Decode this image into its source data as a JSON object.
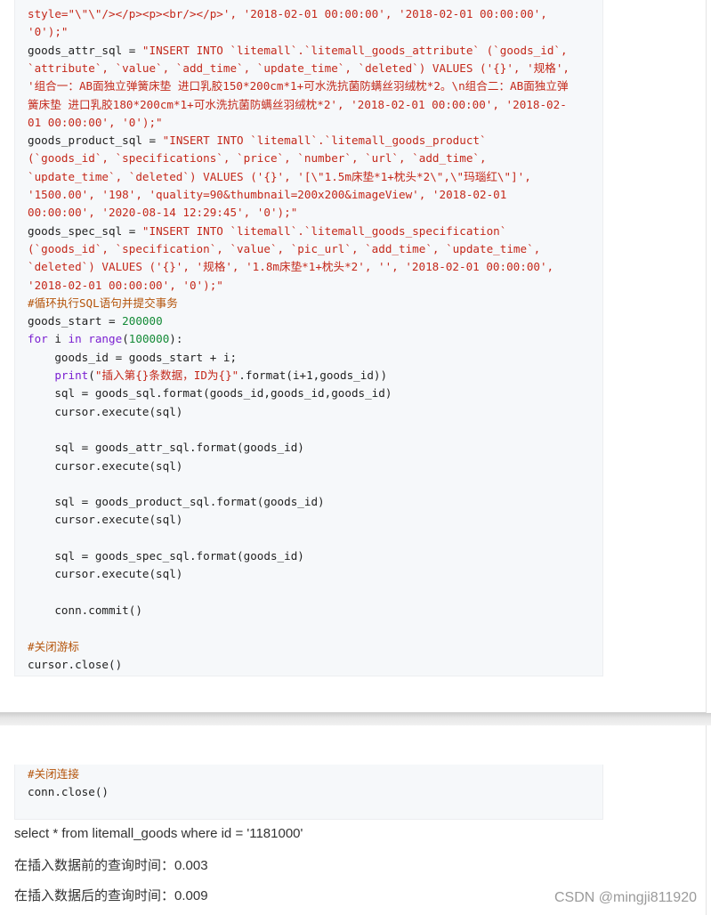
{
  "code_top": {
    "lines": [
      [
        {
          "t": "style=\"\\\"\\\"/></p><p><br/></p>', '2018-02-01 00:00:00', '2018-02-01 00:00:00',",
          "c": "str"
        }
      ],
      [
        {
          "t": "'0');\"",
          "c": "str"
        }
      ],
      [
        {
          "t": "goods_attr_sql = ",
          "c": ""
        },
        {
          "t": "\"INSERT INTO `litemall`.`litemall_goods_attribute` (`goods_id`,",
          "c": "str"
        }
      ],
      [
        {
          "t": "`attribute`, `value`, `add_time`, `update_time`, `deleted`) VALUES ('{}', '规格',",
          "c": "str"
        }
      ],
      [
        {
          "t": "'组合一：AB面独立弹簧床垫 进口乳胶150*200cm*1+可水洗抗菌防螨丝羽绒枕*2。\\n组合二：AB面独立弹",
          "c": "str"
        }
      ],
      [
        {
          "t": "簧床垫 进口乳胶180*200cm*1+可水洗抗菌防螨丝羽绒枕*2', '2018-02-01 00:00:00', '2018-02-",
          "c": "str"
        }
      ],
      [
        {
          "t": "01 00:00:00', '0');\"",
          "c": "str"
        }
      ],
      [
        {
          "t": "goods_product_sql = ",
          "c": ""
        },
        {
          "t": "\"INSERT INTO `litemall`.`litemall_goods_product`",
          "c": "str"
        }
      ],
      [
        {
          "t": "(`goods_id`, `specifications`, `price`, `number`, `url`, `add_time`,",
          "c": "str"
        }
      ],
      [
        {
          "t": "`update_time`, `deleted`) VALUES ('{}', '[\\\"1.5m床垫*1+枕头*2\\\",\\\"玛瑙红\\\"]',",
          "c": "str"
        }
      ],
      [
        {
          "t": "'1500.00', '198', 'quality=90&thumbnail=200x200&imageView', '2018-02-01",
          "c": "str"
        }
      ],
      [
        {
          "t": "00:00:00', '2020-08-14 12:29:45', '0');\"",
          "c": "str"
        }
      ],
      [
        {
          "t": "goods_spec_sql = ",
          "c": ""
        },
        {
          "t": "\"INSERT INTO `litemall`.`litemall_goods_specification`",
          "c": "str"
        }
      ],
      [
        {
          "t": "(`goods_id`, `specification`, `value`, `pic_url`, `add_time`, `update_time`,",
          "c": "str"
        }
      ],
      [
        {
          "t": "`deleted`) VALUES ('{}', '规格', '1.8m床垫*1+枕头*2', '', '2018-02-01 00:00:00',",
          "c": "str"
        }
      ],
      [
        {
          "t": "'2018-02-01 00:00:00', '0');\"",
          "c": "str"
        }
      ],
      [
        {
          "t": "#循环执行SQL语句并提交事务",
          "c": "cmt"
        }
      ],
      [
        {
          "t": "goods_start = ",
          "c": ""
        },
        {
          "t": "200000",
          "c": "num"
        }
      ],
      [
        {
          "t": "for",
          "c": "kw"
        },
        {
          "t": " i ",
          "c": ""
        },
        {
          "t": "in",
          "c": "kw"
        },
        {
          "t": " ",
          "c": ""
        },
        {
          "t": "range",
          "c": "fn"
        },
        {
          "t": "(",
          "c": ""
        },
        {
          "t": "100000",
          "c": "num"
        },
        {
          "t": "):",
          "c": ""
        }
      ],
      [
        {
          "t": "    goods_id = goods_start + i;",
          "c": ""
        }
      ],
      [
        {
          "t": "    ",
          "c": ""
        },
        {
          "t": "print",
          "c": "fn"
        },
        {
          "t": "(",
          "c": ""
        },
        {
          "t": "\"插入第{}条数据，ID为{}\"",
          "c": "str"
        },
        {
          "t": ".format(i+1,goods_id))",
          "c": ""
        }
      ],
      [
        {
          "t": "    sql = goods_sql.format(goods_id,goods_id,goods_id)",
          "c": ""
        }
      ],
      [
        {
          "t": "    cursor.execute(sql)",
          "c": ""
        }
      ],
      [],
      [
        {
          "t": "    sql = goods_attr_sql.format(goods_id)",
          "c": ""
        }
      ],
      [
        {
          "t": "    cursor.execute(sql)",
          "c": ""
        }
      ],
      [],
      [
        {
          "t": "    sql = goods_product_sql.format(goods_id)",
          "c": ""
        }
      ],
      [
        {
          "t": "    cursor.execute(sql)",
          "c": ""
        }
      ],
      [],
      [
        {
          "t": "    sql = goods_spec_sql.format(goods_id)",
          "c": ""
        }
      ],
      [
        {
          "t": "    cursor.execute(sql)",
          "c": ""
        }
      ],
      [],
      [
        {
          "t": "    conn.commit()",
          "c": ""
        }
      ],
      [],
      [
        {
          "t": "#关闭游标",
          "c": "cmt"
        }
      ],
      [
        {
          "t": "cursor.close()",
          "c": ""
        }
      ]
    ]
  },
  "code_bottom": {
    "lines": [
      [
        {
          "t": "#关闭连接",
          "c": "cmt"
        }
      ],
      [
        {
          "t": "conn.close()",
          "c": ""
        }
      ]
    ]
  },
  "article": {
    "query_text": "select * from litemall_goods where id = '1181000'",
    "before_text": "在插入数据前的查询时间：0.003",
    "after_text": "在插入数据后的查询时间：0.009"
  },
  "watermark": "CSDN @mingji811920"
}
